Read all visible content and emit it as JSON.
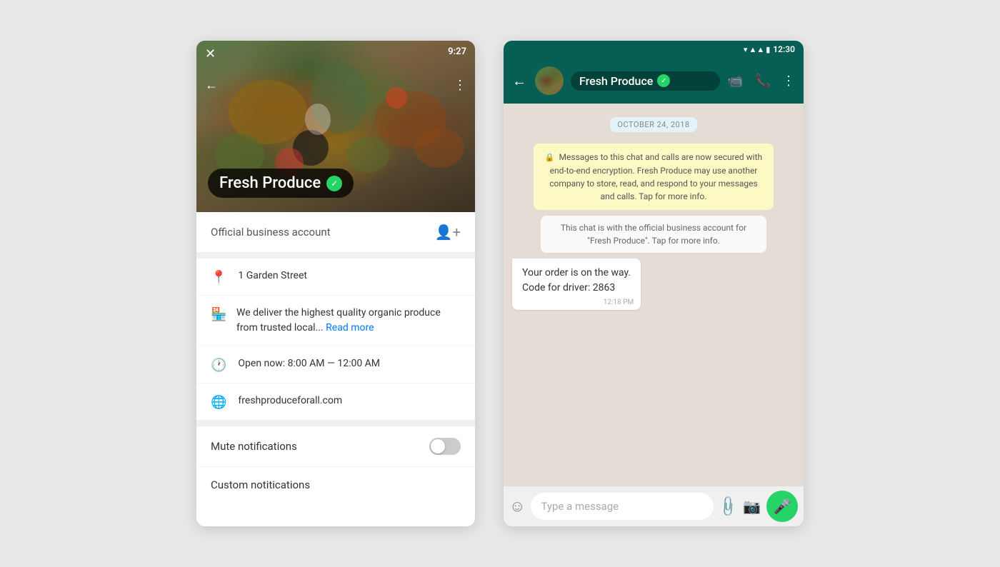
{
  "leftPanel": {
    "time": "9:27",
    "businessName": "Fresh Produce",
    "verifiedSymbol": "✓",
    "officialAccount": "Official business account",
    "address": "1 Garden Street",
    "description": "We deliver the highest quality organic produce from trusted local...",
    "readMore": "Read more",
    "hours": "Open now: 8:00 AM — 12:00 AM",
    "website": "freshproduceforall.com",
    "muteNotifications": "Mute notifications",
    "customNotifications": "Custom notitications"
  },
  "rightPanel": {
    "time": "12:30",
    "chatName": "Fresh Produce",
    "verifiedSymbol": "✓",
    "dateBadge": "OCTOBER 24, 2018",
    "systemMessage1": "Messages to this chat and calls are now secured with end-to-end encryption. Fresh Produce may use another company to store, read, and respond to your messages and calls. Tap for more info.",
    "systemMessage2": "This chat is with the official business account for \"Fresh Produce\". Tap for more info.",
    "bubbleText1": "Your order is on the way.",
    "bubbleText2": "Code for driver: 2863",
    "bubbleTime": "12:18 PM",
    "inputPlaceholder": "Type a message"
  }
}
